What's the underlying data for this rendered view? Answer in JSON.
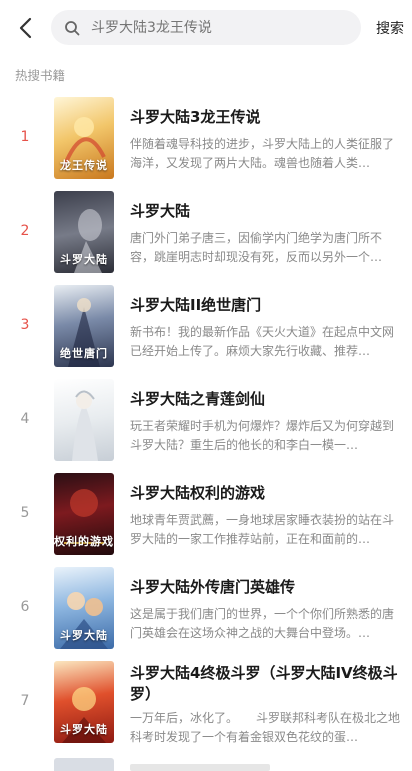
{
  "header": {
    "back_icon": "chevron-left-icon",
    "search_placeholder": "斗罗大陆3龙王传说",
    "search_label": "搜索"
  },
  "section_title": "热搜书籍",
  "colors": {
    "hot_rank": "#e6524a",
    "normal_rank": "#999999"
  },
  "books": [
    {
      "rank": "1",
      "title": "斗罗大陆3龙王传说",
      "desc": "伴随着魂导科技的进步，斗罗大陆上的人类征服了海洋，又发现了两片大陆。魂兽也随着人类…",
      "cover_text": "龙王传说"
    },
    {
      "rank": "2",
      "title": "斗罗大陆",
      "desc": "唐门外门弟子唐三，因偷学内门绝学为唐门所不容，跳崖明志时却现没有死，反而以另外一个…",
      "cover_text": "斗罗大陆"
    },
    {
      "rank": "3",
      "title": "斗罗大陆II绝世唐门",
      "desc": "新书布！我的最新作品《天火大道》在起点中文网已经开始上传了。麻烦大家先行收藏、推荐…",
      "cover_text": "绝世唐门"
    },
    {
      "rank": "4",
      "title": "斗罗大陆之青莲剑仙",
      "desc": "玩王者荣耀时手机为何爆炸？爆炸后又为何穿越到斗罗大陆？重生后的他长的和李白一模一…",
      "cover_text": ""
    },
    {
      "rank": "5",
      "title": "斗罗大陆权利的游戏",
      "desc": "地球青年贾武薦，一身地球居家睡衣装扮的站在斗罗大陆的一家工作推荐站前，正在和面前的…",
      "cover_text": "权利的游戏"
    },
    {
      "rank": "6",
      "title": "斗罗大陆外传唐门英雄传",
      "desc": "这是属于我们唐门的世界，一个个你们所熟悉的唐门英雄会在这场众神之战的大舞台中登场。…",
      "cover_text": "斗罗大陆"
    },
    {
      "rank": "7",
      "title": "斗罗大陆4终极斗罗（斗罗大陆IV终极斗罗）",
      "desc": "一万年后，冰化了。　　斗罗联邦科考队在极北之地科考时发现了一个有着金银双色花纹的蛋…",
      "cover_text": "斗罗大陆"
    }
  ]
}
